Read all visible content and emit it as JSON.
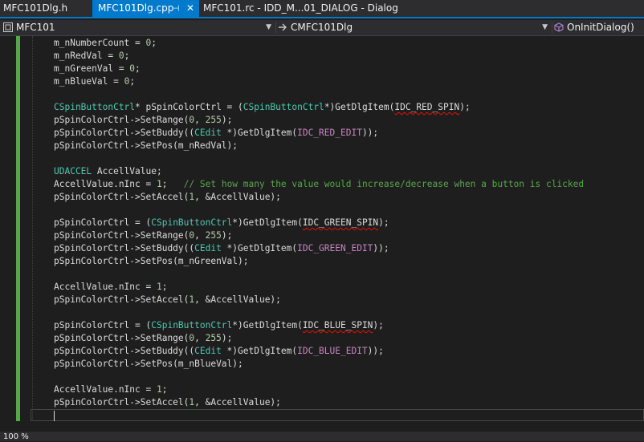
{
  "tabs": [
    {
      "label": "MFC101Dlg.h",
      "active": false
    },
    {
      "label": "MFC101Dlg.cpp",
      "active": true
    },
    {
      "label": "MFC101.rc - IDD_M...01_DIALOG - Dialog",
      "active": false
    }
  ],
  "tab_pin_glyph": "⊣",
  "tab_close_glyph": "✕",
  "navigation": {
    "project": "MFC101",
    "scope": "CMFC101Dlg",
    "member": "OnInitDialog()"
  },
  "code_lines": [
    "m_nNumberCount = 0;",
    "m_nRedVal = 0;",
    "m_nGreenVal = 0;",
    "m_nBlueVal = 0;",
    "",
    "CSpinButtonCtrl* pSpinColorCtrl = (CSpinButtonCtrl*)GetDlgItem(IDC_RED_SPIN);",
    "pSpinColorCtrl->SetRange(0, 255);",
    "pSpinColorCtrl->SetBuddy((CEdit *)GetDlgItem(IDC_RED_EDIT));",
    "pSpinColorCtrl->SetPos(m_nRedVal);",
    "",
    "UDACCEL AccellValue;",
    "AccellValue.nInc = 1;   // Set how many the value would increase/decrease when a button is clicked",
    "pSpinColorCtrl->SetAccel(1, &AccellValue);",
    "",
    "pSpinColorCtrl = (CSpinButtonCtrl*)GetDlgItem(IDC_GREEN_SPIN);",
    "pSpinColorCtrl->SetRange(0, 255);",
    "pSpinColorCtrl->SetBuddy((CEdit *)GetDlgItem(IDC_GREEN_EDIT));",
    "pSpinColorCtrl->SetPos(m_nGreenVal);",
    "",
    "AccellValue.nInc = 1;",
    "pSpinColorCtrl->SetAccel(1, &AccellValue);",
    "",
    "pSpinColorCtrl = (CSpinButtonCtrl*)GetDlgItem(IDC_BLUE_SPIN);",
    "pSpinColorCtrl->SetRange(0, 255);",
    "pSpinColorCtrl->SetBuddy((CEdit *)GetDlgItem(IDC_BLUE_EDIT));",
    "pSpinColorCtrl->SetPos(m_nBlueVal);",
    "",
    "AccellValue.nInc = 1;",
    "pSpinColorCtrl->SetAccel(1, &AccellValue);",
    ""
  ],
  "highlight": {
    "types": [
      "CSpinButtonCtrl",
      "CEdit",
      "UDACCEL"
    ],
    "macros": [
      "IDC_RED_EDIT",
      "IDC_GREEN_EDIT",
      "IDC_BLUE_EDIT"
    ],
    "squiggles": [
      "IDC_RED_SPIN",
      "IDC_GREEN_SPIN",
      "IDC_BLUE_SPIN"
    ]
  },
  "status": {
    "zoom": "100 %"
  },
  "colors": {
    "accent": "#007acc",
    "background": "#1e1e1e",
    "type": "#4ec9b0",
    "macro": "#c586c0",
    "comment": "#57a64a",
    "change_marker": "#57a64a"
  },
  "icons": {
    "project": "cpp-project-icon",
    "scope": "arrow-right-icon",
    "member": "method-cube-icon"
  }
}
